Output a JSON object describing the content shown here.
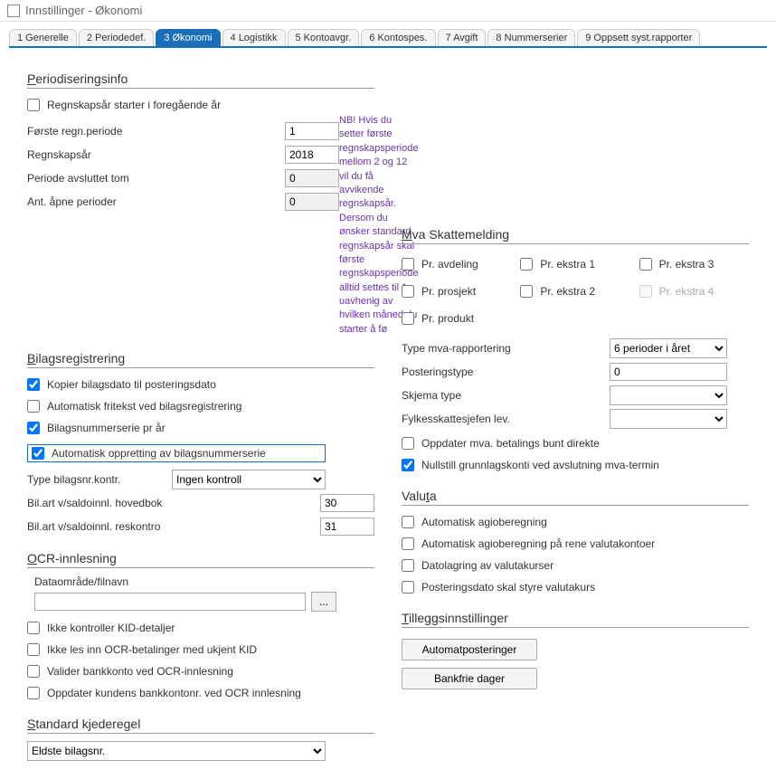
{
  "window": {
    "title": "Innstillinger - Økonomi"
  },
  "tabs": [
    {
      "label": "1 Generelle"
    },
    {
      "label": "2 Periodedef."
    },
    {
      "label": "3 Økonomi"
    },
    {
      "label": "4 Logistikk"
    },
    {
      "label": "5 Kontoavgr."
    },
    {
      "label": "6 Kontospes."
    },
    {
      "label": "7 Avgift"
    },
    {
      "label": "8 Nummerserier"
    },
    {
      "label": "9 Oppsett syst.rapporter"
    }
  ],
  "periodiseringsinfo": {
    "title_prefix": "P",
    "title_rest": "eriodiseringsinfo",
    "regnskapsar_foregaende": "Regnskapsår starter i foregående år",
    "forste_regn_periode_label": "Første regn.periode",
    "forste_regn_periode_value": "1",
    "regnskapsar_label": "Regnskapsår",
    "regnskapsar_value": "2018",
    "periode_avsluttet_tom_label": "Periode avsluttet tom",
    "periode_avsluttet_tom_value": "0",
    "ant_apne_perioder_label": "Ant. åpne perioder",
    "ant_apne_perioder_value": "0",
    "note": "NB! Hvis du setter første regnskapsperiode mellom 2 og 12 vil du få avvikende regnskapsår. Dersom du ønsker standard regnskapsår skal første  regnskapsperiode alltid settes til 1,  uavhenig av hvilken måned du starter å fø"
  },
  "bilagsregistrering": {
    "title_prefix": "B",
    "title_rest": "ilagsregistrering",
    "kopier_bilagsdato": "Kopier bilagsdato til posteringsdato",
    "automatisk_fritekst": "Automatisk fritekst ved bilagsregistrering",
    "bilagsnummerserie_pr_ar": "Bilagsnummerserie pr år",
    "automatisk_oppretting": "Automatisk oppretting av bilagsnummerserie",
    "type_bilagsnr_kontr_label": "Type bilagsnr.kontr.",
    "type_bilagsnr_kontr_value": "Ingen kontroll",
    "bilart_hovedbok_label": "Bil.art v/saldoinnl. hovedbok",
    "bilart_hovedbok_value": "30",
    "bilart_reskontro_label": "Bil.art v/saldoinnl. reskontro",
    "bilart_reskontro_value": "31"
  },
  "ocr": {
    "title_prefix": "O",
    "title_rest": "CR-innlesning",
    "dataomrade_label": "Dataområde/filnavn",
    "dataomrade_value": "",
    "browse": "...",
    "ikke_kontroller_kid": "Ikke kontroller KID-detaljer",
    "ikke_les_ocr_ukjent_kid": "Ikke les inn OCR-betalinger med ukjent KID",
    "valider_bankkonto": "Valider bankkonto ved OCR-innlesning",
    "oppdater_kundens_bankkontonr": "Oppdater kundens bankkontonr. ved OCR innlesning"
  },
  "kjederegel": {
    "title_prefix": "S",
    "title_rest": "tandard kjederegel",
    "value": "Eldste bilagsnr."
  },
  "mva": {
    "title_prefix": "M",
    "title_rest": "va Skattemelding",
    "pr_avdeling": "Pr. avdeling",
    "pr_prosjekt": "Pr. prosjekt",
    "pr_produkt": "Pr. produkt",
    "pr_ekstra_1": "Pr. ekstra 1",
    "pr_ekstra_2": "Pr. ekstra 2",
    "pr_ekstra_3": "Pr. ekstra 3",
    "pr_ekstra_4": "Pr. ekstra 4",
    "type_mva_label": "Type mva-rapportering",
    "type_mva_value": "6 perioder i året",
    "posteringstype_label": "Posteringstype",
    "posteringstype_value": "0",
    "skjema_type_label": "Skjema type",
    "skjema_type_value": "",
    "fylkesskattesjefen_label": "Fylkesskattesjefen lev.",
    "fylkesskattesjefen_value": "",
    "oppdater_mva_betalingsbunt": "Oppdater mva. betalings bunt direkte",
    "nullstill_grunnlagskonti": "Nullstill grunnlagskonti ved avslutning mva-termin"
  },
  "valuta": {
    "title": "Valuta",
    "title_prefix": "Valu",
    "title_u": "t",
    "title_suffix": "a",
    "automatisk_agioberegning": "Automatisk agioberegning",
    "automatisk_agio_rene_valuta": "Automatisk agioberegning på rene valutakontoer",
    "datolagring": "Datolagring av valutakurser",
    "posteringsdato_styre": "Posteringsdato skal styre valutakurs"
  },
  "tillegg": {
    "title_prefix": "T",
    "title_rest": "illeggsinnstillinger",
    "automatposteringer": "Automatposteringer",
    "bankfrie_dager": "Bankfrie dager"
  }
}
